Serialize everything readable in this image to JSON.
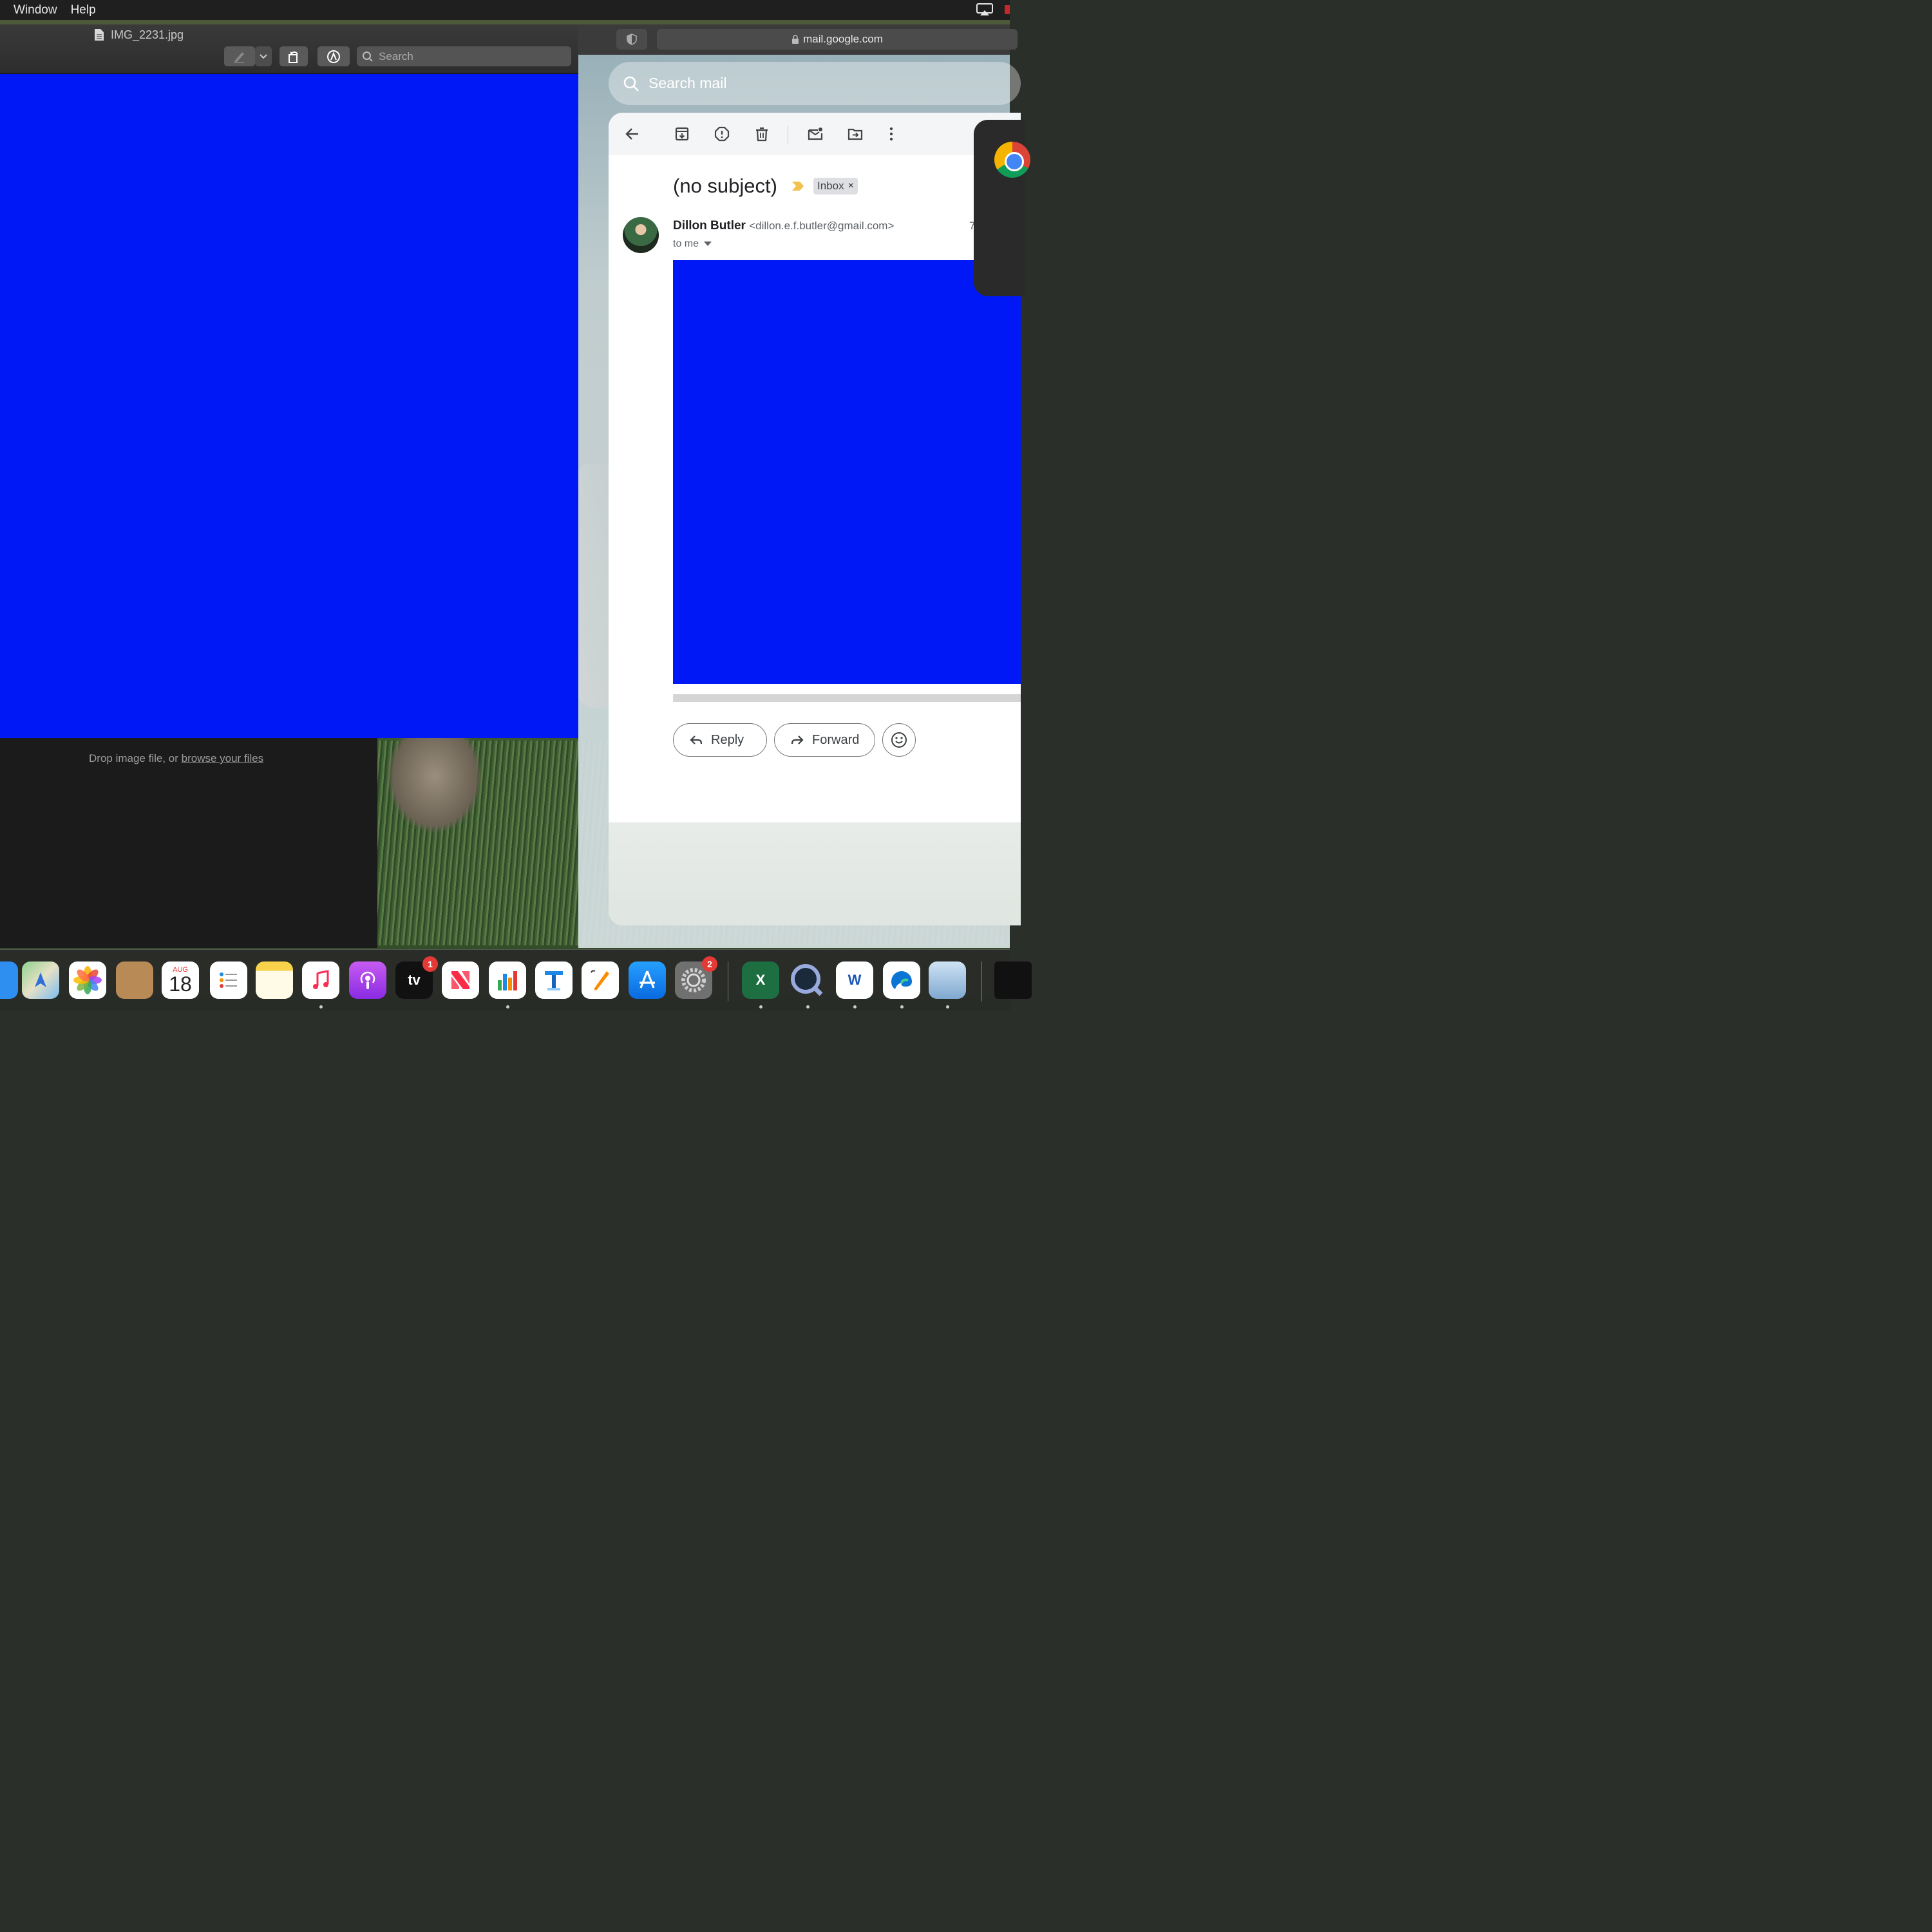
{
  "menubar": {
    "items": [
      "Window",
      "Help"
    ]
  },
  "preview": {
    "filename": "IMG_2231.jpg",
    "search_placeholder": "Search",
    "canvas_color": "#0018f5"
  },
  "dropzone": {
    "text": "Drop image file, or ",
    "link": "browse your files"
  },
  "browser": {
    "url": "mail.google.com"
  },
  "gmail": {
    "search_placeholder": "Search mail",
    "subject": "(no subject)",
    "label_chip": "Inbox",
    "label_remove": "×",
    "sender_name": "Dillon Butler",
    "sender_email": "<dillon.e.f.butler@gmail.com>",
    "recipient": "to me",
    "date_partial": "7",
    "reply_label": "Reply",
    "forward_label": "Forward"
  },
  "dock": {
    "calendar_month": "AUG",
    "calendar_day": "18",
    "tv_label": "tv",
    "tv_badge": "1",
    "settings_badge": "2",
    "excel_letter": "X",
    "word_letter": "W"
  }
}
